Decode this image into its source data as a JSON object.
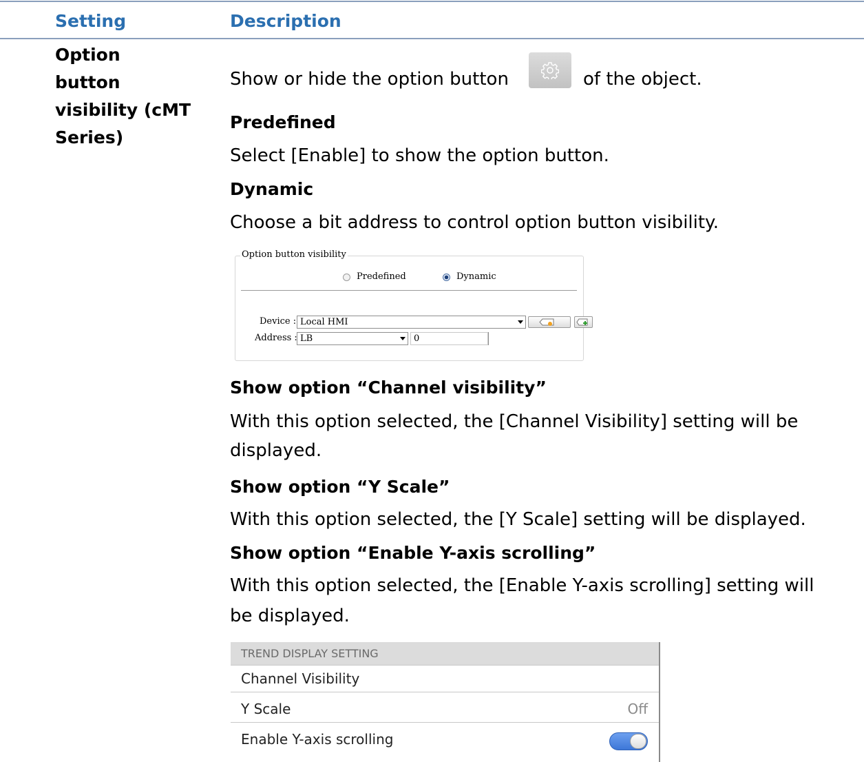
{
  "table": {
    "header_setting": "Setting",
    "header_description": "Description"
  },
  "setting": {
    "line1": "Option",
    "line2": "button",
    "line3": "visibility (cMT",
    "line4": "Series)"
  },
  "description": {
    "intro_before": "Show or hide the option button",
    "intro_after": "of the object.",
    "predefined_head": "Predefined",
    "predefined_text": "Select [Enable] to show the option button.",
    "dynamic_head": "Dynamic",
    "dynamic_text": "Choose a bit address to control option button visibility.",
    "channel_head": "Show option “Channel visibility”",
    "channel_text1": "With this option selected, the [Channel Visibility] setting will be",
    "channel_text2": "displayed.",
    "yscale_head": "Show option “Y Scale”",
    "yscale_text": "With this option selected, the [Y Scale] setting will be displayed.",
    "scroll_head": "Show option “Enable Y-axis scrolling”",
    "scroll_text1": "With this option selected, the [Enable Y-axis scrolling] setting will",
    "scroll_text2": "be displayed."
  },
  "dialog": {
    "group_title": "Option button visibility",
    "radio_predefined": "Predefined",
    "radio_dynamic": "Dynamic",
    "selected_mode": "Dynamic",
    "device_label": "Device :",
    "device_value": "Local HMI",
    "address_label": "Address :",
    "address_type": "LB",
    "address_value": "0"
  },
  "panel": {
    "section_title": "TREND DISPLAY SETTING",
    "row1": "Channel Visibility",
    "row2": "Y Scale",
    "row2_value": "Off",
    "row3": "Enable Y-axis scrolling",
    "row3_toggle_on": true,
    "toggle_color": "#4a86e8"
  },
  "icons": {
    "option_button": "gear-icon"
  }
}
